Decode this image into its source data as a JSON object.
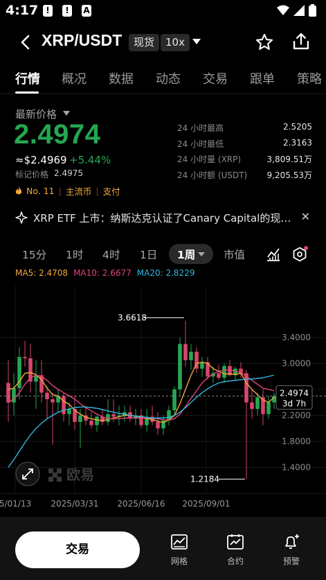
{
  "status": {
    "time": "4:17",
    "icon_a": "A"
  },
  "header": {
    "pair": "XRP/USDT",
    "market_tag": "现货",
    "leverage_tag": "10x"
  },
  "tabs": [
    "行情",
    "概况",
    "数据",
    "动态",
    "交易",
    "跟单",
    "策略"
  ],
  "price": {
    "label": "最新价格",
    "last": "2.4974",
    "usd": "≈$2.4969",
    "change": "+5.44%",
    "mark_label": "标记价格",
    "mark_value": "2.4975",
    "rank": "No. 11",
    "tag1": "主流币",
    "tag2": "支付"
  },
  "stats": [
    {
      "label": "24 小时最高",
      "value": "2.5205"
    },
    {
      "label": "24 小时最低",
      "value": "2.3163"
    },
    {
      "label": "24 小时量 (XRP)",
      "value": "3,809.51万"
    },
    {
      "label": "24 小时额 (USDT)",
      "value": "9,205.53万"
    }
  ],
  "news": {
    "text": "XRP ETF 上市：纳斯达克认证了Canary Capital的现货XRP ETF"
  },
  "intervals": [
    "15分",
    "1时",
    "4时",
    "1日",
    "1周",
    "市值"
  ],
  "chart_data": {
    "type": "candlestick",
    "interval": "1周",
    "y_ticks": [
      "3.4000",
      "3.0000",
      "2.6000",
      "2.2000",
      "1.8000",
      "1.4000"
    ],
    "ylim": [
      1.0,
      4.2
    ],
    "x_ticks": [
      "5/01/13",
      "2025/03/31",
      "2025/06/16",
      "2025/09/01"
    ],
    "ma": [
      {
        "name": "MA5",
        "value": "2.4708",
        "color": "#f3a73b"
      },
      {
        "name": "MA10",
        "value": "2.6677",
        "color": "#e0457b"
      },
      {
        "name": "MA20",
        "value": "2.8229",
        "color": "#35b6e0"
      }
    ],
    "max_label": "3.6618",
    "min_label": "1.2184",
    "current_price": "2.4974",
    "countdown": "3d 7h",
    "watermark": "欧易",
    "up_color": "#25a750",
    "down_color": "#d6456c",
    "candles": [
      {
        "o": 2.7,
        "h": 3.05,
        "l": 2.1,
        "c": 2.4
      },
      {
        "o": 2.4,
        "h": 2.85,
        "l": 2.2,
        "c": 2.62
      },
      {
        "o": 2.62,
        "h": 3.25,
        "l": 2.45,
        "c": 3.1
      },
      {
        "o": 3.1,
        "h": 3.35,
        "l": 2.95,
        "c": 3.08
      },
      {
        "o": 3.08,
        "h": 3.3,
        "l": 2.55,
        "c": 2.72
      },
      {
        "o": 2.72,
        "h": 3.05,
        "l": 2.3,
        "c": 2.82
      },
      {
        "o": 2.82,
        "h": 3.05,
        "l": 2.4,
        "c": 2.55
      },
      {
        "o": 2.55,
        "h": 2.65,
        "l": 2.15,
        "c": 2.45
      },
      {
        "o": 2.45,
        "h": 2.55,
        "l": 1.75,
        "c": 2.4
      },
      {
        "o": 2.4,
        "h": 2.6,
        "l": 2.25,
        "c": 2.5
      },
      {
        "o": 2.5,
        "h": 2.55,
        "l": 2.1,
        "c": 2.22
      },
      {
        "o": 2.22,
        "h": 2.4,
        "l": 2.05,
        "c": 2.3
      },
      {
        "o": 2.3,
        "h": 2.5,
        "l": 1.98,
        "c": 2.1
      },
      {
        "o": 2.1,
        "h": 2.3,
        "l": 1.7,
        "c": 2.2
      },
      {
        "o": 2.2,
        "h": 2.35,
        "l": 2.05,
        "c": 2.12
      },
      {
        "o": 2.12,
        "h": 2.25,
        "l": 2.0,
        "c": 2.05
      },
      {
        "o": 2.05,
        "h": 2.2,
        "l": 1.95,
        "c": 2.18
      },
      {
        "o": 2.18,
        "h": 2.3,
        "l": 2.05,
        "c": 2.1
      },
      {
        "o": 2.1,
        "h": 2.45,
        "l": 2.05,
        "c": 2.22
      },
      {
        "o": 2.22,
        "h": 2.45,
        "l": 2.1,
        "c": 2.18
      },
      {
        "o": 2.18,
        "h": 2.35,
        "l": 2.05,
        "c": 2.2
      },
      {
        "o": 2.2,
        "h": 2.35,
        "l": 2.1,
        "c": 2.25
      },
      {
        "o": 2.25,
        "h": 2.35,
        "l": 2.1,
        "c": 2.15
      },
      {
        "o": 2.15,
        "h": 2.3,
        "l": 2.05,
        "c": 2.2
      },
      {
        "o": 2.2,
        "h": 2.3,
        "l": 2.0,
        "c": 2.05
      },
      {
        "o": 2.05,
        "h": 2.3,
        "l": 1.95,
        "c": 2.18
      },
      {
        "o": 2.18,
        "h": 2.35,
        "l": 2.05,
        "c": 2.1
      },
      {
        "o": 2.1,
        "h": 2.25,
        "l": 1.9,
        "c": 2.0
      },
      {
        "o": 2.0,
        "h": 2.2,
        "l": 1.9,
        "c": 2.12
      },
      {
        "o": 2.12,
        "h": 2.35,
        "l": 2.05,
        "c": 2.28
      },
      {
        "o": 2.28,
        "h": 2.65,
        "l": 2.2,
        "c": 2.6
      },
      {
        "o": 2.6,
        "h": 3.4,
        "l": 2.5,
        "c": 3.3
      },
      {
        "o": 3.3,
        "h": 3.66,
        "l": 2.95,
        "c": 3.05
      },
      {
        "o": 3.05,
        "h": 3.3,
        "l": 2.9,
        "c": 3.18
      },
      {
        "o": 3.18,
        "h": 3.25,
        "l": 2.85,
        "c": 2.92
      },
      {
        "o": 2.92,
        "h": 3.1,
        "l": 2.8,
        "c": 3.02
      },
      {
        "o": 3.02,
        "h": 3.1,
        "l": 2.75,
        "c": 2.8
      },
      {
        "o": 2.8,
        "h": 2.95,
        "l": 2.7,
        "c": 2.85
      },
      {
        "o": 2.85,
        "h": 2.98,
        "l": 2.75,
        "c": 2.78
      },
      {
        "o": 2.78,
        "h": 3.0,
        "l": 2.7,
        "c": 2.96
      },
      {
        "o": 2.96,
        "h": 3.05,
        "l": 2.8,
        "c": 2.82
      },
      {
        "o": 2.82,
        "h": 2.95,
        "l": 2.75,
        "c": 2.92
      },
      {
        "o": 2.92,
        "h": 3.02,
        "l": 2.78,
        "c": 2.85
      },
      {
        "o": 2.85,
        "h": 2.9,
        "l": 1.22,
        "c": 2.4
      },
      {
        "o": 2.4,
        "h": 2.6,
        "l": 2.15,
        "c": 2.3
      },
      {
        "o": 2.3,
        "h": 2.55,
        "l": 2.2,
        "c": 2.48
      },
      {
        "o": 2.48,
        "h": 2.6,
        "l": 2.05,
        "c": 2.22
      },
      {
        "o": 2.22,
        "h": 2.5,
        "l": 2.15,
        "c": 2.4
      },
      {
        "o": 2.4,
        "h": 2.55,
        "l": 2.3,
        "c": 2.5
      }
    ],
    "ma5": [
      2.6,
      2.62,
      2.72,
      2.85,
      2.86,
      2.83,
      2.75,
      2.62,
      2.52,
      2.5,
      2.42,
      2.37,
      2.28,
      2.22,
      2.17,
      2.15,
      2.13,
      2.12,
      2.14,
      2.16,
      2.18,
      2.2,
      2.2,
      2.19,
      2.17,
      2.15,
      2.14,
      2.11,
      2.09,
      2.13,
      2.2,
      2.38,
      2.6,
      2.82,
      3.0,
      3.02,
      3.0,
      2.92,
      2.88,
      2.84,
      2.84,
      2.83,
      2.85,
      2.7,
      2.6,
      2.52,
      2.44,
      2.4,
      2.48
    ],
    "ma10": [
      2.4,
      2.45,
      2.55,
      2.68,
      2.78,
      2.82,
      2.8,
      2.74,
      2.66,
      2.6,
      2.55,
      2.5,
      2.45,
      2.38,
      2.32,
      2.27,
      2.22,
      2.18,
      2.15,
      2.15,
      2.15,
      2.16,
      2.16,
      2.16,
      2.16,
      2.16,
      2.16,
      2.15,
      2.13,
      2.13,
      2.15,
      2.22,
      2.34,
      2.46,
      2.58,
      2.7,
      2.78,
      2.84,
      2.88,
      2.9,
      2.9,
      2.88,
      2.86,
      2.8,
      2.74,
      2.68,
      2.62,
      2.6,
      2.58
    ],
    "ma20": [
      1.4,
      1.52,
      1.65,
      1.78,
      1.9,
      2.0,
      2.08,
      2.15,
      2.2,
      2.25,
      2.28,
      2.3,
      2.32,
      2.33,
      2.33,
      2.32,
      2.31,
      2.29,
      2.27,
      2.25,
      2.23,
      2.22,
      2.2,
      2.19,
      2.18,
      2.17,
      2.16,
      2.16,
      2.16,
      2.17,
      2.2,
      2.25,
      2.32,
      2.4,
      2.48,
      2.55,
      2.61,
      2.66,
      2.7,
      2.72,
      2.73,
      2.74,
      2.75,
      2.76,
      2.76,
      2.77,
      2.78,
      2.8,
      2.82
    ]
  },
  "bottom": {
    "trade": "交易",
    "grid": "网格",
    "futures": "合约",
    "alert": "预警"
  }
}
